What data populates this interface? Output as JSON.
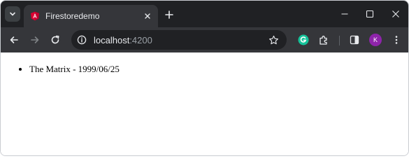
{
  "window": {
    "tab": {
      "title": "Firestoredemo",
      "favicon": "angular-logo-icon",
      "favicon_color": "#dd0031"
    },
    "controls": [
      "minimize-icon",
      "maximize-icon",
      "close-icon"
    ]
  },
  "toolbar": {
    "url_host": "localhost",
    "url_port": ":4200",
    "profile_initial": "K",
    "profile_color": "#8e24aa",
    "extensions": [
      "grammarly-icon",
      "puzzle-icon",
      "side-panel-icon"
    ]
  },
  "page": {
    "movies": [
      {
        "text": "The Matrix - 1999/06/25"
      }
    ]
  }
}
